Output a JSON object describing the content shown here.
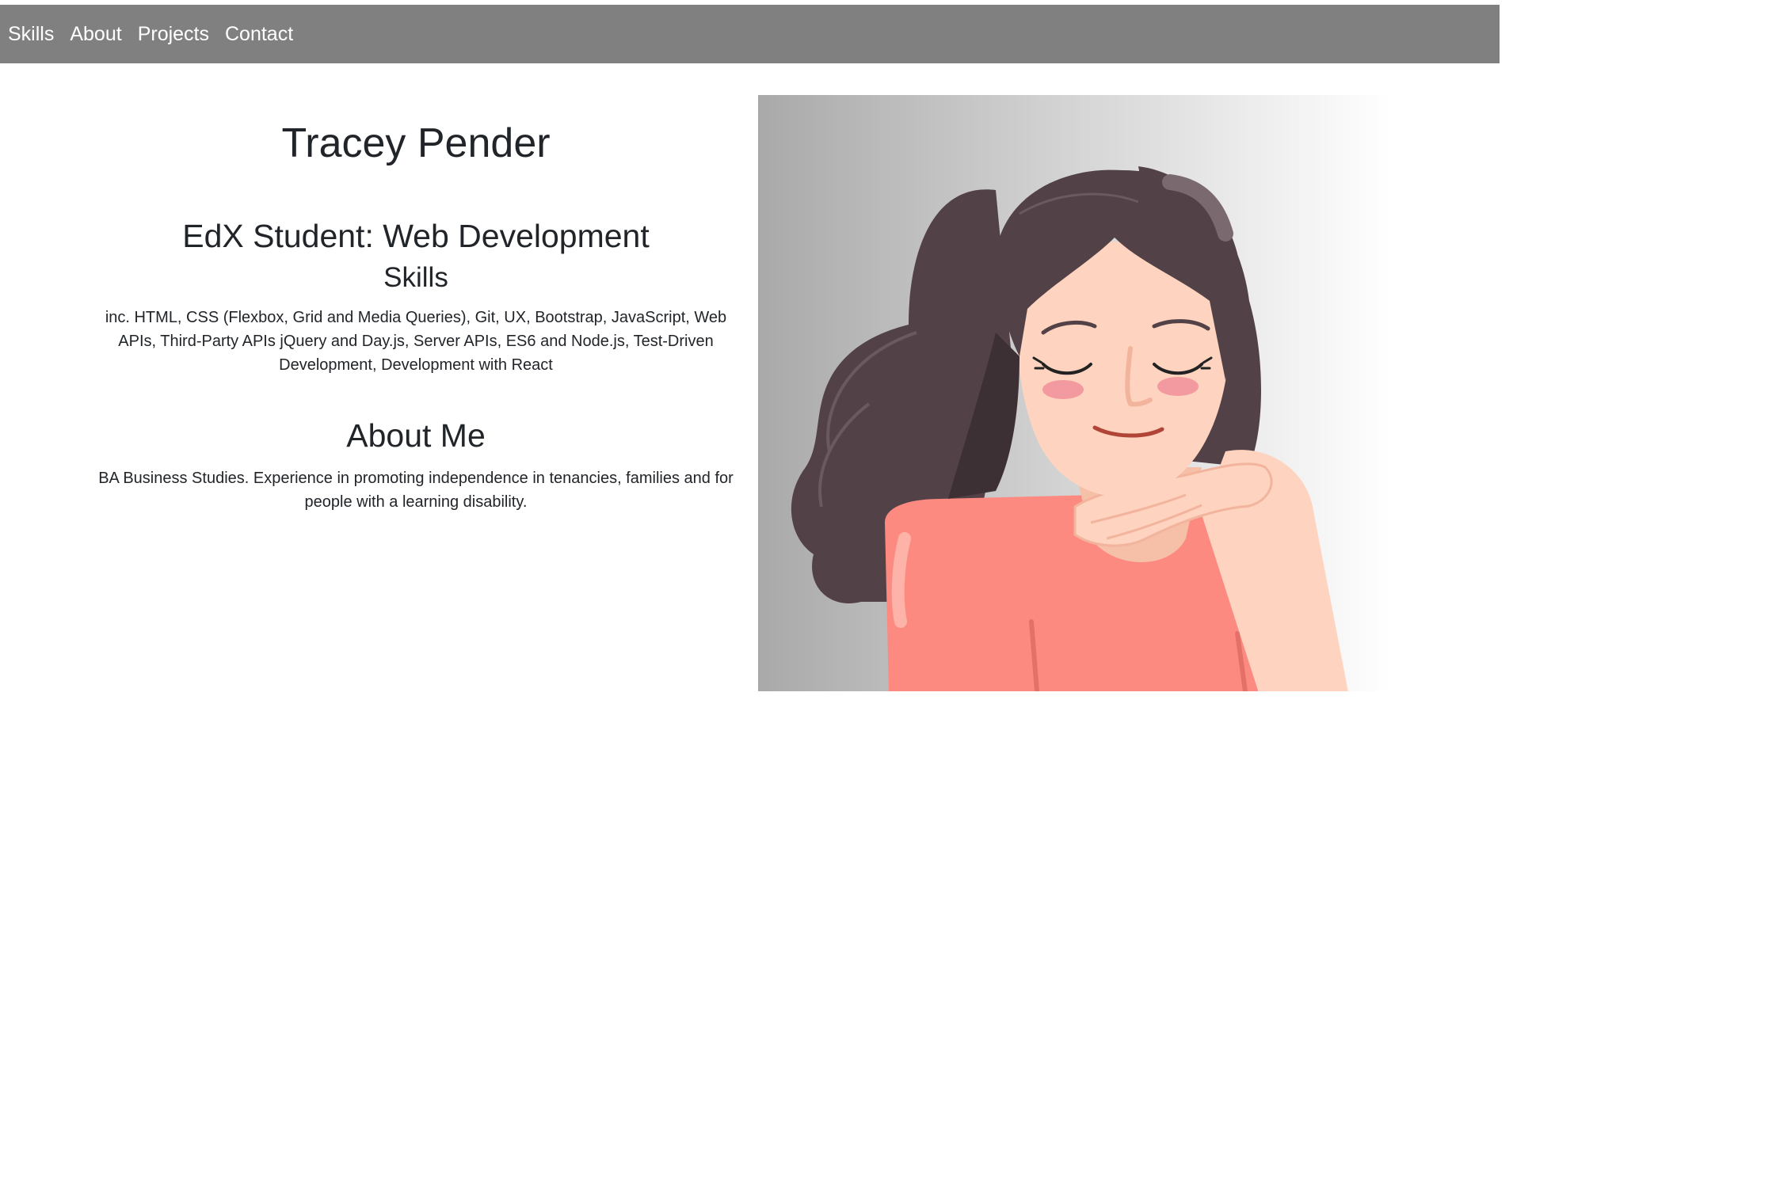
{
  "nav": {
    "items": [
      "Skills",
      "About",
      "Projects",
      "Contact"
    ]
  },
  "intro": {
    "name": "Tracey Pender",
    "role": "EdX Student: Web Development",
    "skills_title": "Skills",
    "skills_text": "inc. HTML, CSS (Flexbox, Grid and Media Queries), Git, UX, Bootstrap, JavaScript, Web APIs, Third-Party APIs jQuery and Day.js, Server APIs, ES6 and Node.js, Test-Driven Development, Development with React",
    "about_title": "About Me",
    "about_text": "BA Business Studies. Experience in promoting independence in tenancies, families and for people with a learning disability."
  },
  "portrait": {
    "icon": "portrait-illustration"
  },
  "colors": {
    "navbar": "#808080",
    "text": "#212529",
    "hair": "#524247",
    "skin": "#fed3bf",
    "shirt": "#fc8a80"
  }
}
